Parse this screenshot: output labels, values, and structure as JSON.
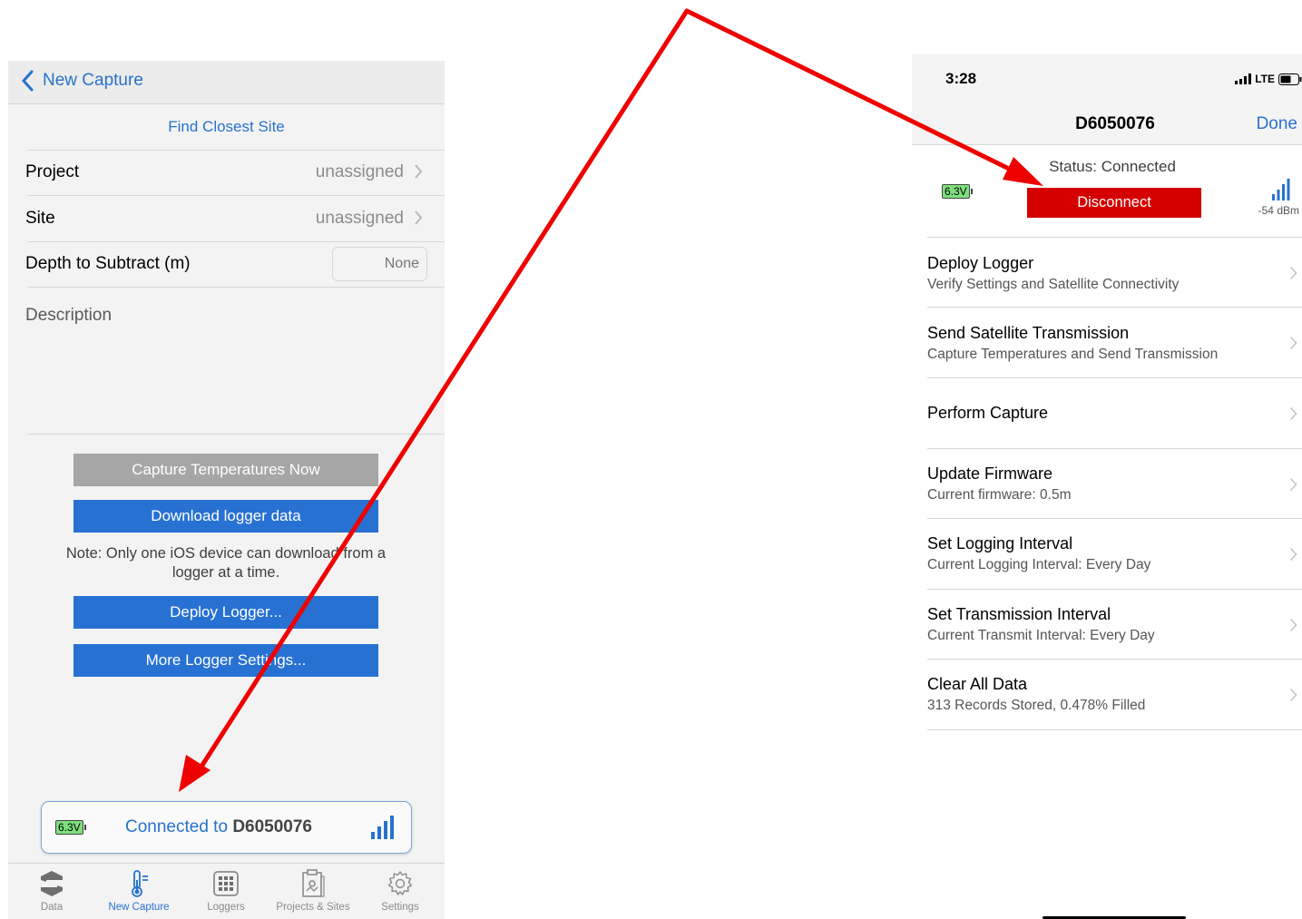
{
  "left": {
    "nav": {
      "back_label": "New Capture"
    },
    "find_closest_site": "Find Closest Site",
    "rows": {
      "project": {
        "label": "Project",
        "value": "unassigned"
      },
      "site": {
        "label": "Site",
        "value": "unassigned"
      },
      "depth": {
        "label": "Depth to Subtract (m)",
        "placeholder": "None"
      }
    },
    "description_label": "Description",
    "buttons": {
      "capture_temps": "Capture Temperatures Now",
      "download": "Download logger data",
      "deploy": "Deploy Logger...",
      "more_settings": "More Logger Settings..."
    },
    "note": "Note: Only one iOS device can download from a logger at a time.",
    "connection": {
      "battery": "6.3V",
      "connected_word": "Connected",
      "to_word": " to ",
      "device": "D6050076"
    },
    "tabs": [
      {
        "label": "Data",
        "icon": "data-logo-icon"
      },
      {
        "label": "New Capture",
        "icon": "thermometer-icon"
      },
      {
        "label": "Loggers",
        "icon": "grid-icon"
      },
      {
        "label": "Projects & Sites",
        "icon": "clipboard-map-icon"
      },
      {
        "label": "Settings",
        "icon": "gear-icon"
      }
    ],
    "active_tab": "New Capture"
  },
  "right": {
    "time": "3:28",
    "network": "LTE",
    "title": "D6050076",
    "done": "Done",
    "status": "Status: Connected",
    "battery": "6.3V",
    "disconnect": "Disconnect",
    "signal_dbm": "-54 dBm",
    "menu": [
      {
        "title": "Deploy Logger",
        "subtitle": "Verify Settings and Satellite Connectivity"
      },
      {
        "title": "Send Satellite Transmission",
        "subtitle": "Capture Temperatures and Send Transmission"
      },
      {
        "title": "Perform Capture",
        "subtitle": ""
      },
      {
        "title": "Update Firmware",
        "subtitle": "Current firmware: 0.5m"
      },
      {
        "title": "Set Logging Interval",
        "subtitle": "Current Logging Interval: Every Day"
      },
      {
        "title": "Set Transmission Interval",
        "subtitle": "Current Transmit Interval: Every Day"
      },
      {
        "title": "Clear All Data",
        "subtitle": "313 Records Stored, 0.478% Filled"
      }
    ]
  },
  "colors": {
    "accent_blue": "#2772cc",
    "button_blue": "#2771d3",
    "disconnect_red": "#d40000",
    "arrow_red": "#ee0000",
    "battery_green": "#7de07d"
  }
}
